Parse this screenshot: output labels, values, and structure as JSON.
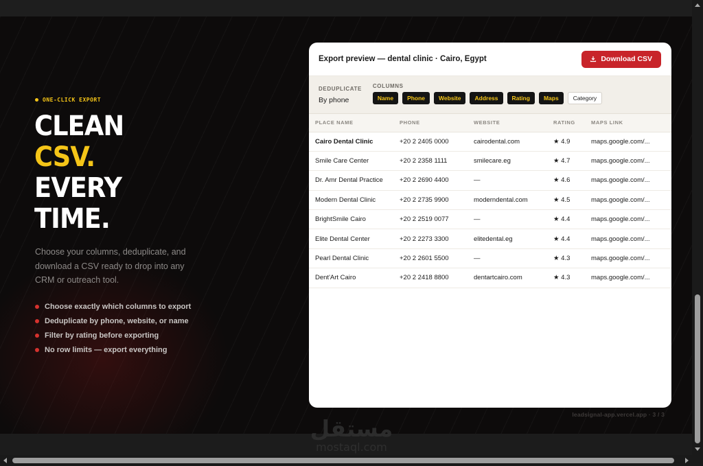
{
  "hero": {
    "eyebrow": "ONE-CLICK EXPORT",
    "headline": [
      "CLEAN",
      "CSV.",
      "EVERY",
      "TIME."
    ],
    "description": "Choose your columns, deduplicate, and download a CSV ready to drop into any CRM or outreach tool.",
    "bullets": [
      "Choose exactly which columns to export",
      "Deduplicate by phone, website, or name",
      "Filter by rating before exporting",
      "No row limits — export everything"
    ]
  },
  "preview": {
    "title": "Export preview — dental clinic · Cairo, Egypt",
    "download_label": "Download CSV",
    "download_icon": "download-icon",
    "dedup_label": "DEDUPLICATE",
    "dedup_value": "By phone",
    "columns_label": "COLUMNS",
    "columns": [
      {
        "label": "Name",
        "selected": true
      },
      {
        "label": "Phone",
        "selected": true
      },
      {
        "label": "Website",
        "selected": true
      },
      {
        "label": "Address",
        "selected": true
      },
      {
        "label": "Rating",
        "selected": true
      },
      {
        "label": "Maps",
        "selected": true
      },
      {
        "label": "Category",
        "selected": false
      }
    ],
    "table_headers": [
      "PLACE NAME",
      "PHONE",
      "WEBSITE",
      "RATING",
      "MAPS LINK"
    ],
    "rows": [
      {
        "name": "Cairo Dental Clinic",
        "phone": "+20 2 2405 0000",
        "website": "cairodental.com",
        "rating": "★ 4.9",
        "maps": "maps.google.com/..."
      },
      {
        "name": "Smile Care Center",
        "phone": "+20 2 2358 1111",
        "website": "smilecare.eg",
        "rating": "★ 4.7",
        "maps": "maps.google.com/..."
      },
      {
        "name": "Dr. Amr Dental Practice",
        "phone": "+20 2 2690 4400",
        "website": "—",
        "rating": "★ 4.6",
        "maps": "maps.google.com/..."
      },
      {
        "name": "Modern Dental Clinic",
        "phone": "+20 2 2735 9900",
        "website": "moderndental.com",
        "rating": "★ 4.5",
        "maps": "maps.google.com/..."
      },
      {
        "name": "BrightSmile Cairo",
        "phone": "+20 2 2519 0077",
        "website": "—",
        "rating": "★ 4.4",
        "maps": "maps.google.com/..."
      },
      {
        "name": "Elite Dental Center",
        "phone": "+20 2 2273 3300",
        "website": "elitedental.eg",
        "rating": "★ 4.4",
        "maps": "maps.google.com/..."
      },
      {
        "name": "Pearl Dental Clinic",
        "phone": "+20 2 2601 5500",
        "website": "—",
        "rating": "★ 4.3",
        "maps": "maps.google.com/..."
      },
      {
        "name": "Dent'Art Cairo",
        "phone": "+20 2 2418 8800",
        "website": "dentartcairo.com",
        "rating": "★ 4.3",
        "maps": "maps.google.com/..."
      }
    ]
  },
  "footer_note": "leadsignal-app.vercel.app · 3 / 3",
  "watermark": {
    "arabic": "مستقل",
    "latin": "mostaql.com"
  },
  "colors": {
    "accent": "#f5c518",
    "brand_red": "#c8242a",
    "bullet_red": "#d6322e",
    "background": "#0d0b0b"
  }
}
